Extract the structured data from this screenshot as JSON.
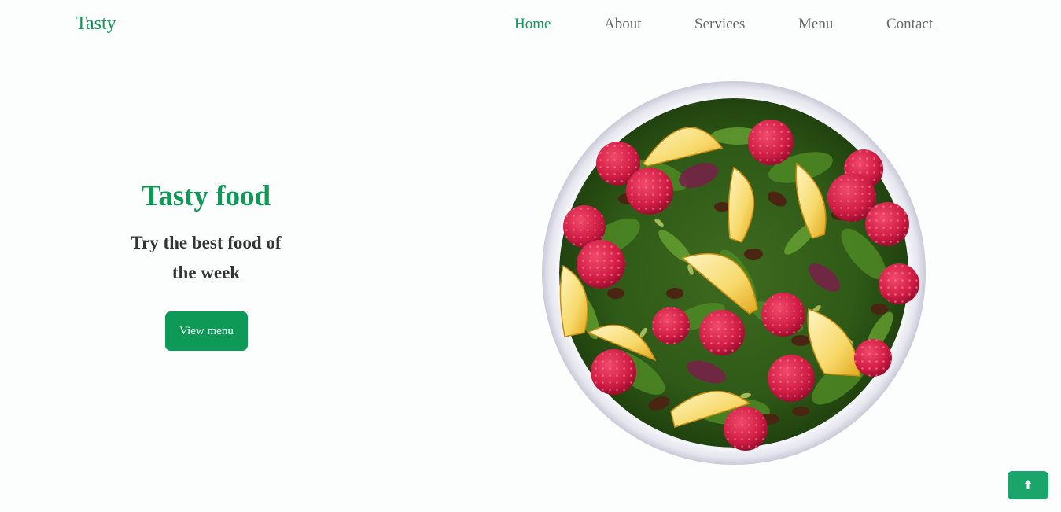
{
  "header": {
    "logo": "Tasty",
    "nav": [
      {
        "label": "Home",
        "active": true
      },
      {
        "label": "About",
        "active": false
      },
      {
        "label": "Services",
        "active": false
      },
      {
        "label": "Menu",
        "active": false
      },
      {
        "label": "Contact",
        "active": false
      }
    ]
  },
  "hero": {
    "title": "Tasty food",
    "subtitle": "Try the best food of the week",
    "cta_label": "View menu",
    "image": "salad-bowl"
  },
  "scroll_top": {
    "icon": "arrow-up-icon"
  },
  "colors": {
    "accent": "#0e9956",
    "text_dark": "#333333",
    "nav_text": "#6b6b6b",
    "background": "#fbfefd"
  }
}
